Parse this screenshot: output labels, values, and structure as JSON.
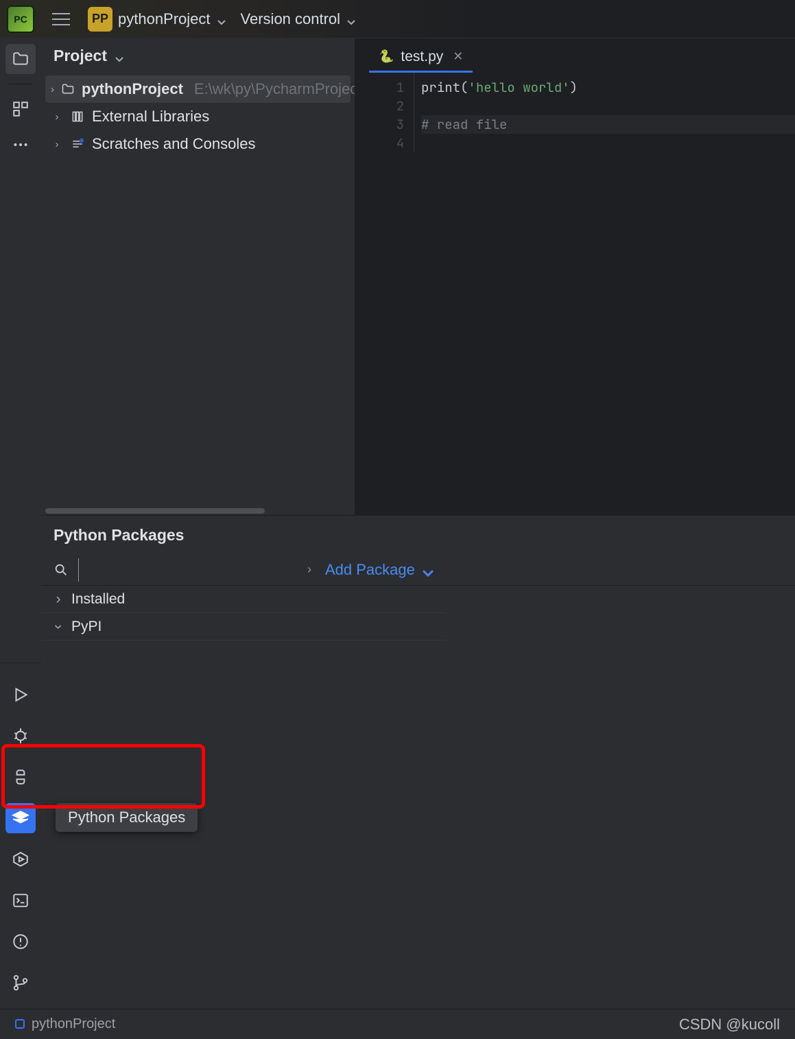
{
  "topbar": {
    "pp_badge": "PP",
    "project_name": "pythonProject",
    "vcs_label": "Version control"
  },
  "project_panel": {
    "title": "Project",
    "items": [
      {
        "name": "pythonProject",
        "path": "E:\\wk\\py\\PycharmProjec",
        "bold": true,
        "icon": "folder",
        "selected": true
      },
      {
        "name": "External Libraries",
        "icon": "library"
      },
      {
        "name": "Scratches and Consoles",
        "icon": "scratch"
      }
    ]
  },
  "editor": {
    "tab": {
      "icon": "🐍",
      "name": "test.py"
    },
    "gutter": [
      "1",
      "2",
      "3",
      "4"
    ],
    "code": [
      {
        "tokens": [
          {
            "t": "print",
            "c": "fn"
          },
          {
            "t": "(",
            "c": "par"
          },
          {
            "t": "'hello world'",
            "c": "str"
          },
          {
            "t": ")",
            "c": "par"
          }
        ]
      },
      {
        "tokens": []
      },
      {
        "tokens": [
          {
            "t": "# read file",
            "c": "com"
          }
        ],
        "current": true
      },
      {
        "tokens": []
      }
    ]
  },
  "packages_panel": {
    "title": "Python Packages",
    "add_label": "Add Package",
    "search_placeholder": "",
    "rows": [
      {
        "expand": "right",
        "label": "Installed"
      },
      {
        "expand": "down",
        "label": "PyPI"
      }
    ],
    "tooltip": "Python Packages"
  },
  "statusbar": {
    "project": "pythonProject",
    "watermark": "CSDN @kucoll"
  }
}
